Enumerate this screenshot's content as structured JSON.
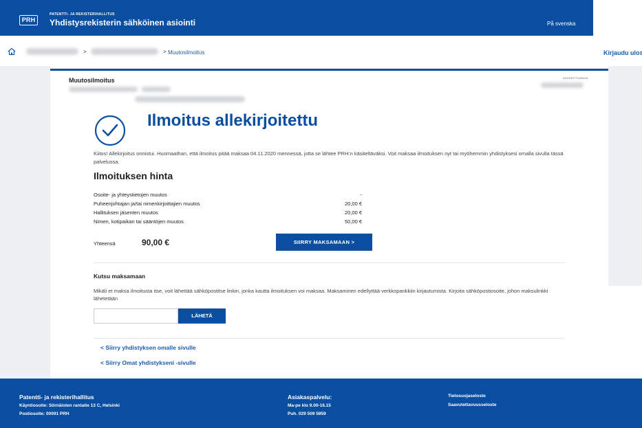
{
  "header": {
    "logo": "PRH",
    "org_small": "PATENTTI- JA REKISTERIHALLITUS",
    "site_title": "Yhdistysrekisterin sähköinen asiointi",
    "lang_link": "På svenska"
  },
  "breadcrumb": {
    "separator": ">",
    "current": "Muutosilmoitus",
    "login": "Kirjaudu ulos"
  },
  "card": {
    "title": "Muutosilmoitus",
    "meta_right": "ASIOINTITUNNUS"
  },
  "success": {
    "heading": "Ilmoitus allekirjoitettu",
    "text": "Kiitos! Allekirjoitus onnistui. Huomaathan, että ilmoitus pitää maksaa 04.11.2020 mennessä, jotta se lähtee PRH:n käsiteltäväksi. Voit maksaa ilmoituksen nyt tai myöhemmin yhdistyksesi omalla sivulla tässä palvelussa."
  },
  "price": {
    "heading": "Ilmoituksen hinta",
    "rows": [
      {
        "label": "Osoite- ja yhteystietojen muutos",
        "value": "-"
      },
      {
        "label": "Puheenjohtajan ja/tai nimenkirjoittajien muutos",
        "value": "20,00 €"
      },
      {
        "label": "Hallituksen jäsenten muutos",
        "value": "20,00 €"
      },
      {
        "label": "Nimen, kotipaikan tai sääntöjen muutos",
        "value": "50,00 €"
      }
    ],
    "total_label": "Yhteensä",
    "total_value": "90,00 €",
    "pay_button": "SIIRRY MAKSAMAAN >"
  },
  "invite": {
    "heading": "Kutsu maksamaan",
    "text": "Mikäli et maksa ilmoitusta itse, voit lähettää sähköpostitse linkin, jonka kautta ilmoituksen voi maksaa. Maksaminen edellyttää verkkopankkiin kirjautumista. Kirjoita sähköpostiosoite, johon maksulinkki lähetetään",
    "email_value": "",
    "send_button": "LÄHETÄ"
  },
  "links": {
    "own_page": "< Siirry yhdistyksen omalle sivulle",
    "my_associations": "< Siirry Omat yhdistykseni -sivulle"
  },
  "footer": {
    "org_name": "Patentti- ja rekisterihallitus",
    "visit_address": "Käyntiosoite: Sörnäisten rantatie 13 C, Helsinki",
    "postal_address": "Postiosoite: 00091 PRH",
    "service_title": "Asiakaspalvelu:",
    "service_hours": "Ma-pe klo 9.00-16.15",
    "service_phone": "Puh. 029 509 5959",
    "privacy_link": "Tietosuojaseloste",
    "accessibility_link": "Saavutettavuusseloste"
  },
  "colors": {
    "brand_blue": "#0a4ea2",
    "link_blue": "#1a5bb0",
    "side_gray": "#eef0f3"
  }
}
